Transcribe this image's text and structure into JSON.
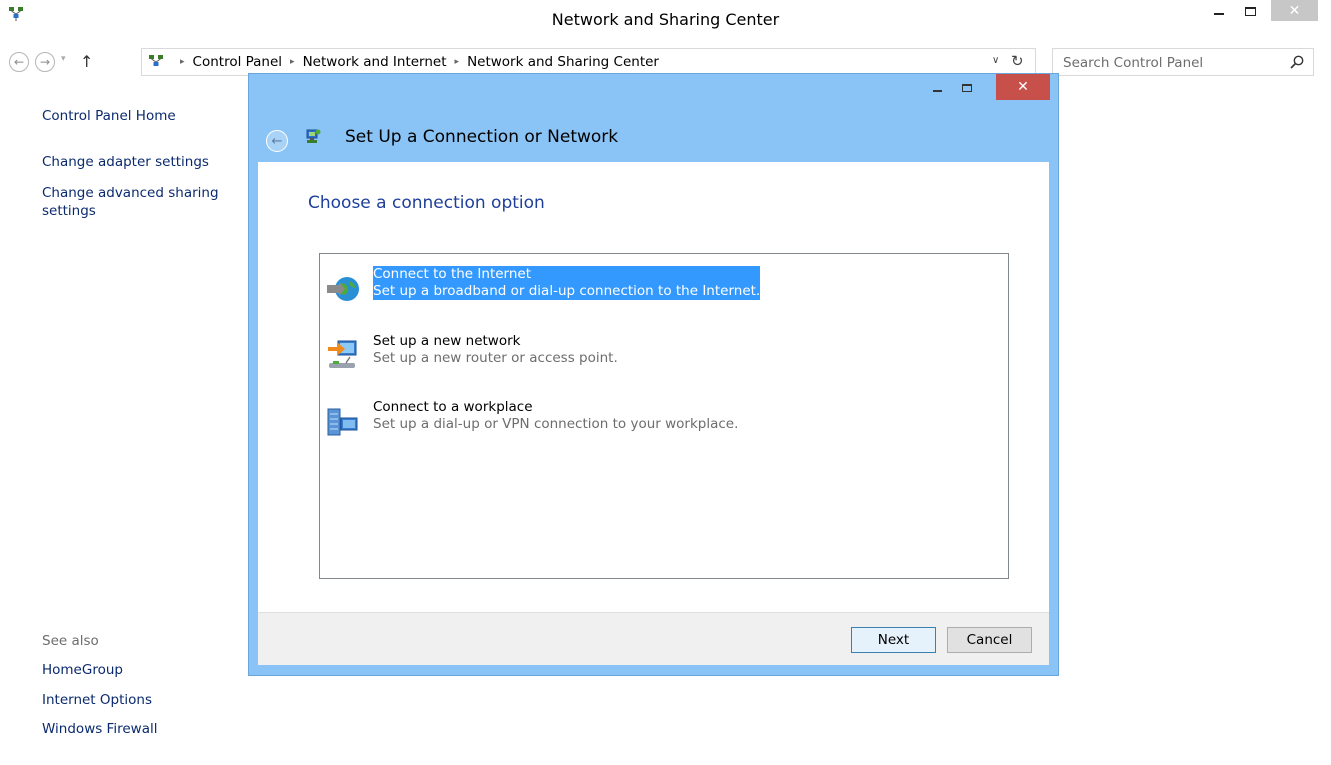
{
  "window": {
    "title": "Network and Sharing Center",
    "close_glyph": "✕"
  },
  "nav": {
    "back_glyph": "←",
    "forward_glyph": "→",
    "dropdown_glyph": "▾",
    "up_glyph": "↑",
    "breadcrumbs": [
      "Control Panel",
      "Network and Internet",
      "Network and Sharing Center"
    ],
    "breadcrumb_separator": "▸",
    "address_dropdown_glyph": "∨",
    "refresh_glyph": "↻",
    "search_placeholder": "Search Control Panel"
  },
  "sidebar": {
    "home": "Control Panel Home",
    "adapter": "Change adapter settings",
    "advanced_line1": "Change advanced sharing",
    "advanced_line2": "settings",
    "see_also_heading": "See also",
    "see_also": [
      "HomeGroup",
      "Internet Options",
      "Windows Firewall"
    ]
  },
  "dialog": {
    "title": "Set Up a Connection or Network",
    "close_glyph": "✕",
    "back_glyph": "←",
    "heading": "Choose a connection option",
    "options": [
      {
        "title": "Connect to the Internet",
        "desc": "Set up a broadband or dial-up connection to the Internet.",
        "icon": "globe-icon",
        "selected": true
      },
      {
        "title": "Set up a new network",
        "desc": "Set up a new router or access point.",
        "icon": "router-icon",
        "selected": false
      },
      {
        "title": "Connect to a workplace",
        "desc": "Set up a dial-up or VPN connection to your workplace.",
        "icon": "workplace-icon",
        "selected": false
      }
    ],
    "next_label": "Next",
    "cancel_label": "Cancel"
  },
  "colors": {
    "dialog_chrome": "#8ac3f5",
    "selection": "#3399ff",
    "link": "#0b2a6e",
    "heading": "#1e3f9a",
    "close_red": "#c7504b"
  }
}
